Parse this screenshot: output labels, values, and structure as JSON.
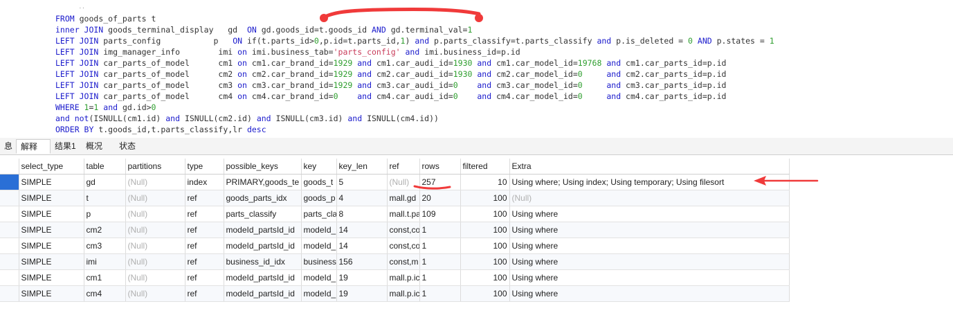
{
  "sql_lines": [
    [
      [
        "kw",
        "FROM "
      ],
      [
        "t",
        "goods_of_parts t"
      ]
    ],
    [
      [
        "kw",
        "inner JOIN "
      ],
      [
        "t",
        "goods_terminal_display   gd  "
      ],
      [
        "kw",
        "ON "
      ],
      [
        "t",
        "gd.goods_id=t.goods_id "
      ],
      [
        "kw",
        "AND "
      ],
      [
        "t",
        "gd.terminal_val="
      ],
      [
        "num",
        "1"
      ]
    ],
    [
      [
        "kw",
        "LEFT JOIN "
      ],
      [
        "t",
        "parts_config           p   "
      ],
      [
        "kw",
        "ON "
      ],
      [
        "t",
        "if(t.parts_id>"
      ],
      [
        "num",
        "0"
      ],
      [
        "t",
        ",p.id=t.parts_id,"
      ],
      [
        "num",
        "1"
      ],
      [
        "t",
        ") "
      ],
      [
        "kw",
        "and "
      ],
      [
        "t",
        "p.parts_classify=t.parts_classify "
      ],
      [
        "kw",
        "and "
      ],
      [
        "t",
        "p.is_deleted = "
      ],
      [
        "num",
        "0"
      ],
      [
        "t",
        " "
      ],
      [
        "kw",
        "AND "
      ],
      [
        "t",
        "p.states = "
      ],
      [
        "num",
        "1"
      ]
    ],
    [
      [
        "kw",
        "LEFT JOIN "
      ],
      [
        "t",
        "img_manager_info        imi "
      ],
      [
        "kw",
        "on "
      ],
      [
        "t",
        "imi.business_tab="
      ],
      [
        "str",
        "'parts_config'"
      ],
      [
        "t",
        " "
      ],
      [
        "kw",
        "and "
      ],
      [
        "t",
        "imi.business_id=p.id"
      ]
    ],
    [
      [
        "kw",
        "LEFT JOIN "
      ],
      [
        "t",
        "car_parts_of_model      cm1 "
      ],
      [
        "kw",
        "on "
      ],
      [
        "t",
        "cm1.car_brand_id="
      ],
      [
        "num",
        "1929"
      ],
      [
        "t",
        " "
      ],
      [
        "kw",
        "and "
      ],
      [
        "t",
        "cm1.car_audi_id="
      ],
      [
        "num",
        "1930"
      ],
      [
        "t",
        " "
      ],
      [
        "kw",
        "and "
      ],
      [
        "t",
        "cm1.car_model_id="
      ],
      [
        "num",
        "19768"
      ],
      [
        "t",
        " "
      ],
      [
        "kw",
        "and "
      ],
      [
        "t",
        "cm1.car_parts_id=p.id"
      ]
    ],
    [
      [
        "kw",
        "LEFT JOIN "
      ],
      [
        "t",
        "car_parts_of_model      cm2 "
      ],
      [
        "kw",
        "on "
      ],
      [
        "t",
        "cm2.car_brand_id="
      ],
      [
        "num",
        "1929"
      ],
      [
        "t",
        " "
      ],
      [
        "kw",
        "and "
      ],
      [
        "t",
        "cm2.car_audi_id="
      ],
      [
        "num",
        "1930"
      ],
      [
        "t",
        " "
      ],
      [
        "kw",
        "and "
      ],
      [
        "t",
        "cm2.car_model_id="
      ],
      [
        "num",
        "0"
      ],
      [
        "t",
        "     "
      ],
      [
        "kw",
        "and "
      ],
      [
        "t",
        "cm2.car_parts_id=p.id"
      ]
    ],
    [
      [
        "kw",
        "LEFT JOIN "
      ],
      [
        "t",
        "car_parts_of_model      cm3 "
      ],
      [
        "kw",
        "on "
      ],
      [
        "t",
        "cm3.car_brand_id="
      ],
      [
        "num",
        "1929"
      ],
      [
        "t",
        " "
      ],
      [
        "kw",
        "and "
      ],
      [
        "t",
        "cm3.car_audi_id="
      ],
      [
        "num",
        "0"
      ],
      [
        "t",
        "    "
      ],
      [
        "kw",
        "and "
      ],
      [
        "t",
        "cm3.car_model_id="
      ],
      [
        "num",
        "0"
      ],
      [
        "t",
        "     "
      ],
      [
        "kw",
        "and "
      ],
      [
        "t",
        "cm3.car_parts_id=p.id"
      ]
    ],
    [
      [
        "kw",
        "LEFT JOIN "
      ],
      [
        "t",
        "car_parts_of_model      cm4 "
      ],
      [
        "kw",
        "on "
      ],
      [
        "t",
        "cm4.car_brand_id="
      ],
      [
        "num",
        "0"
      ],
      [
        "t",
        "    "
      ],
      [
        "kw",
        "and "
      ],
      [
        "t",
        "cm4.car_audi_id="
      ],
      [
        "num",
        "0"
      ],
      [
        "t",
        "    "
      ],
      [
        "kw",
        "and "
      ],
      [
        "t",
        "cm4.car_model_id="
      ],
      [
        "num",
        "0"
      ],
      [
        "t",
        "     "
      ],
      [
        "kw",
        "and "
      ],
      [
        "t",
        "cm4.car_parts_id=p.id"
      ]
    ],
    [
      [
        "kw",
        "WHERE "
      ],
      [
        "num",
        "1"
      ],
      [
        "t",
        "="
      ],
      [
        "num",
        "1"
      ],
      [
        "t",
        " "
      ],
      [
        "kw",
        "and "
      ],
      [
        "t",
        "gd.id>"
      ],
      [
        "num",
        "0"
      ]
    ],
    [
      [
        "kw",
        "and not"
      ],
      [
        "t",
        "(ISNULL(cm1.id) "
      ],
      [
        "kw",
        "and "
      ],
      [
        "t",
        "ISNULL(cm2.id) "
      ],
      [
        "kw",
        "and "
      ],
      [
        "t",
        "ISNULL(cm3.id) "
      ],
      [
        "kw",
        "and "
      ],
      [
        "t",
        "ISNULL(cm4.id))"
      ]
    ],
    [
      [
        "kw",
        "ORDER BY "
      ],
      [
        "t",
        "t.goods_id,t.parts_classify,lr "
      ],
      [
        "kw",
        "desc"
      ]
    ]
  ],
  "sql_cut_line": "     y_",
  "tabs": [
    {
      "label": "息",
      "active": false
    },
    {
      "label": "解释",
      "active": true
    },
    {
      "label": "结果1",
      "active": false
    },
    {
      "label": "概况",
      "active": false
    },
    {
      "label": "状态",
      "active": false
    }
  ],
  "columns": [
    "select_type",
    "table",
    "partitions",
    "type",
    "possible_keys",
    "key",
    "key_len",
    "ref",
    "rows",
    "filtered",
    "Extra"
  ],
  "rows": [
    [
      "SIMPLE",
      "gd",
      "(Null)",
      "index",
      "PRIMARY,goods_te",
      "goods_t",
      "5",
      "(Null)",
      "257",
      "10",
      "Using where; Using index; Using temporary; Using filesort"
    ],
    [
      "SIMPLE",
      "t",
      "(Null)",
      "ref",
      "goods_parts_idx",
      "goods_p",
      "4",
      "mall.gd",
      "20",
      "100",
      "(Null)"
    ],
    [
      "SIMPLE",
      "p",
      "(Null)",
      "ref",
      "parts_classify",
      "parts_cla",
      "8",
      "mall.t.pa",
      "109",
      "100",
      "Using where"
    ],
    [
      "SIMPLE",
      "cm2",
      "(Null)",
      "ref",
      "modeId_partsId_id",
      "modeId_",
      "14",
      "const,co",
      "1",
      "100",
      "Using where"
    ],
    [
      "SIMPLE",
      "cm3",
      "(Null)",
      "ref",
      "modeId_partsId_id",
      "modeId_",
      "14",
      "const,co",
      "1",
      "100",
      "Using where"
    ],
    [
      "SIMPLE",
      "imi",
      "(Null)",
      "ref",
      "business_id_idx",
      "business",
      "156",
      "const,m",
      "1",
      "100",
      "Using where"
    ],
    [
      "SIMPLE",
      "cm1",
      "(Null)",
      "ref",
      "modeId_partsId_id",
      "modeId_",
      "19",
      "mall.p.ic",
      "1",
      "100",
      "Using where"
    ],
    [
      "SIMPLE",
      "cm4",
      "(Null)",
      "ref",
      "modeId_partsId_id",
      "modeId_",
      "19",
      "mall.p.ic",
      "1",
      "100",
      "Using where"
    ]
  ],
  "colors": {
    "keyword": "#1a1acc",
    "number": "#2e9e2e",
    "string": "#c83c5a",
    "annotation": "#f03a3a",
    "selection": "#2a6fd6"
  }
}
